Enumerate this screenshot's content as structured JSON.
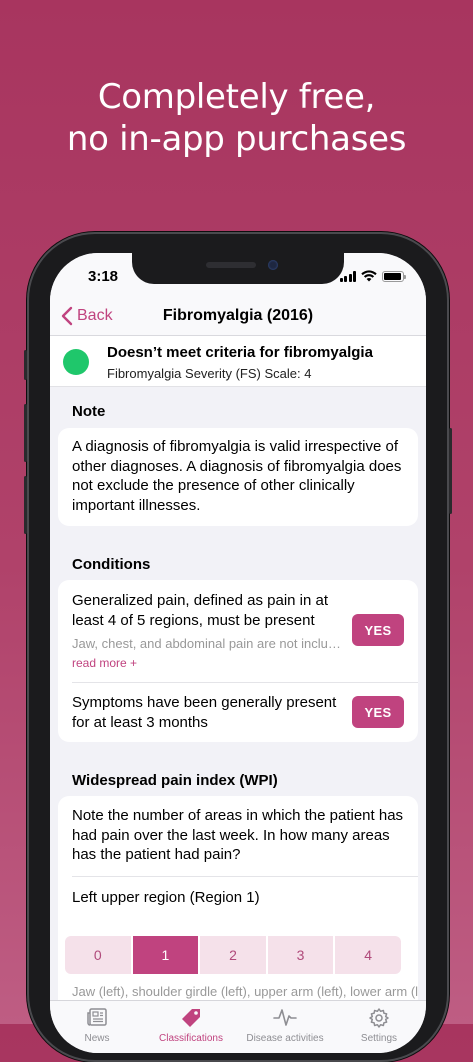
{
  "headline": {
    "line1": "Completely free,",
    "line2": "no in-app purchases"
  },
  "colors": {
    "accent": "#c0437f",
    "status_green": "#1fc76b",
    "background": "#a8355f"
  },
  "status_bar": {
    "time": "3:18"
  },
  "nav": {
    "back_label": "Back",
    "title": "Fibromyalgia (2016)"
  },
  "result": {
    "status_color": "#1fc76b",
    "title": "Doesn’t meet criteria for fibromyalgia",
    "subtitle": "Fibromyalgia Severity (FS) Scale: 4"
  },
  "note": {
    "heading": "Note",
    "text": "A diagnosis of fibromyalgia is valid irrespective of other diagnoses. A diagnosis of fibromyalgia does not exclude the presence of other clinically important illnesses."
  },
  "conditions": {
    "heading": "Conditions",
    "items": [
      {
        "text": "Generalized pain, defined as pain in at least 4 of 5 regions, must be present",
        "description": "Jaw, chest, and abdominal pain are not included in generalized pain definition",
        "read_more": "read more +",
        "answer": "YES"
      },
      {
        "text": "Symptoms have been generally present for at least 3 months",
        "answer": "YES"
      }
    ]
  },
  "wpi": {
    "heading": "Widespread pain index (WPI)",
    "intro": "Note the number of areas in which the patient has had pain over the last week. In how many areas has the patient had pain?",
    "region_label": "Left upper region (Region 1)",
    "options": [
      "0",
      "1",
      "2",
      "3",
      "4"
    ],
    "selected": "1",
    "region_description": "Jaw (left), shoulder girdle (left), upper arm (left), lower arm (left)"
  },
  "tab_bar": {
    "items": [
      {
        "label": "News",
        "icon": "newspaper-icon"
      },
      {
        "label": "Classifications",
        "icon": "tag-icon",
        "active": true
      },
      {
        "label": "Disease activities",
        "icon": "pulse-icon"
      },
      {
        "label": "Settings",
        "icon": "gear-icon"
      }
    ]
  }
}
